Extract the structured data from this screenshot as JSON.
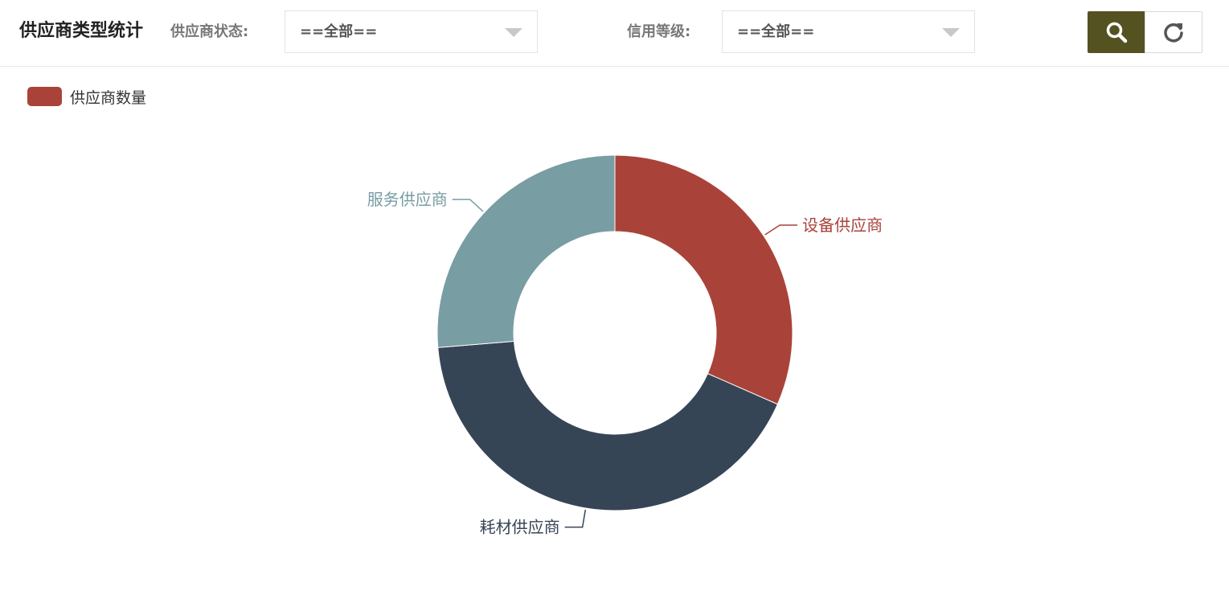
{
  "header": {
    "title": "供应商类型统计",
    "status_filter": {
      "label": "供应商状态:",
      "value": "==全部=="
    },
    "credit_filter": {
      "label": "信用等级:",
      "value": "==全部=="
    }
  },
  "icons": {
    "search": "search-icon",
    "refresh": "refresh-icon",
    "dropdown": "chevron-down-icon"
  },
  "colors": {
    "accent": "#545221",
    "border": "#e3e3e3"
  },
  "chart_data": {
    "type": "pie",
    "donut": true,
    "legend": {
      "entries": [
        {
          "name": "供应商数量",
          "color": "#a9433a"
        }
      ],
      "placement": "top-left"
    },
    "slices": [
      {
        "label": "设备供应商",
        "value": 3,
        "color": "#a9433a"
      },
      {
        "label": "耗材供应商",
        "value": 4,
        "color": "#364556"
      },
      {
        "label": "服务供应商",
        "value": 2.5,
        "color": "#789da3"
      }
    ]
  }
}
